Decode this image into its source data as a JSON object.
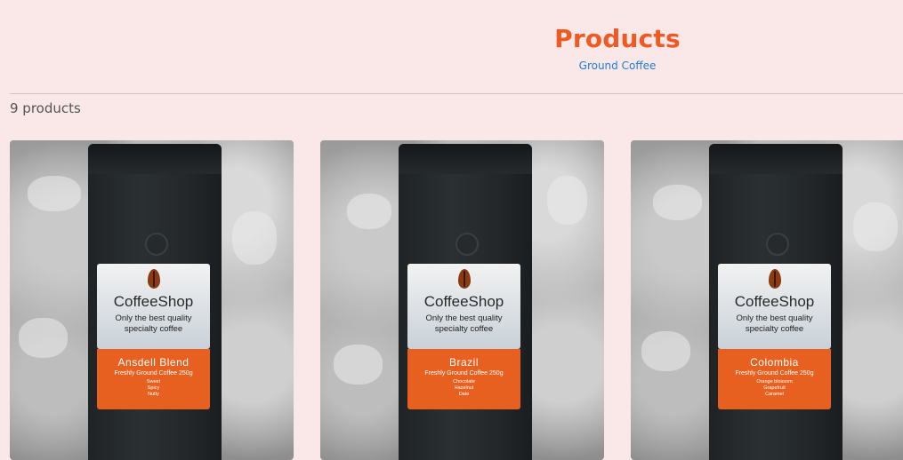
{
  "page": {
    "title": "Products",
    "breadcrumb": "Ground Coffee",
    "product_count": "9 products"
  },
  "products": [
    {
      "brand": "CoffeeShop",
      "tagline": "Only the best quality\nspecialty coffee",
      "name": "Ansdell Blend",
      "subtitle": "Freshly Ground Coffee 250g",
      "notes": [
        "Sweet",
        "Spicy",
        "Nutty"
      ]
    },
    {
      "brand": "CoffeeShop",
      "tagline": "Only the best quality\nspecialty coffee",
      "name": "Brazil",
      "subtitle": "Freshly Ground Coffee 250g",
      "notes": [
        "Chocolate",
        "Hazelnut",
        "Date"
      ]
    },
    {
      "brand": "CoffeeShop",
      "tagline": "Only the best quality\nspecialty coffee",
      "name": "Colombia",
      "subtitle": "Freshly Ground Coffee 250g",
      "notes": [
        "Orange blossom",
        "Grapefruit",
        "Caramel"
      ]
    }
  ],
  "colors": {
    "background": "#f9e8e7",
    "title": "#ef5a24",
    "link": "#1f7fd6",
    "label_orange": "#e8601f"
  }
}
